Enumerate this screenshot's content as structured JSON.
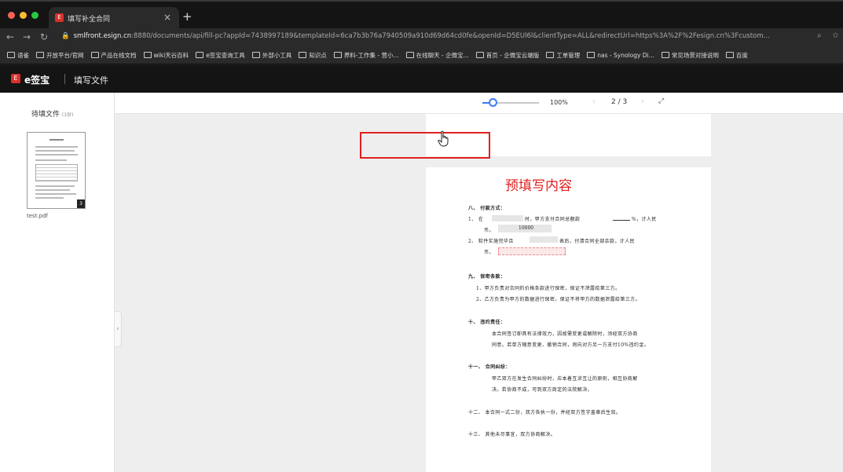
{
  "browser": {
    "tab_title": "填写补全合同",
    "close_symbol": "×",
    "new_tab_symbol": "+",
    "url_host": "smlfront.esign.cn",
    "url_rest": ":8880/documents/api/fill-pc?appId=7438997189&templateId=6ca7b3b76a7940509a910d69d64cd0fe&openId=D5EUl6l&clientType=ALL&redirectUrl=https%3A%2F%2Fesign.cn%3Fcustom...",
    "bookmarks": [
      "语雀",
      "开放平台/官网",
      "产品在线文档",
      "wiki天谷百科",
      "e签宝查询工具",
      "外部小工具",
      "知识点",
      "养料-工作集 - 营小...",
      "在线聊天 - 企微宝...",
      "首页 - 企微宝云端版",
      "工单管理",
      "nas - Synology Di...",
      "常见场景对接说明",
      "百度"
    ]
  },
  "app": {
    "logo_mark": "E",
    "logo_text": "e签宝",
    "title": "填写文件"
  },
  "sidebar": {
    "title": "待填文件",
    "count": "(1份)",
    "file_name": "test.pdf",
    "page_badge": "3"
  },
  "toolbar": {
    "zoom_level": "100%",
    "zoom_fraction": 0.15,
    "current_page": "2",
    "page_separator": "/",
    "total_pages": "3",
    "prev_symbol": "‹",
    "next_symbol": "›",
    "expand_symbol": "⤢"
  },
  "document": {
    "sec8_title": "八、  付款方式：",
    "sec8_l1a": "1、 在",
    "sec8_l1b": "时，甲方支付合同总额款",
    "sec8_l1c": "%，计人民",
    "sec8_l2a": "币。",
    "sec8_field_value": "10000",
    "sec8_l3a": "2、 软件实施完毕且",
    "sec8_l3b": "表后，付清合同全部余款，计人民",
    "sec8_l4a": "币。",
    "sec9_title": "九、  保密条款：",
    "sec9_l1": "1、甲方负责对合同的价格条款进行保密，保证不泄露给第三方。",
    "sec9_l2": "2、乙方负责为甲方的数据进行保密，保证不将甲方的数据泄露给第三方。",
    "sec10_title": "十、  违约责任：",
    "sec10_l1": "本合同签订即具有法律效力，因故需变更或解除时，须经双方协商",
    "sec10_l2": "同意。若单方随意变更、撤销合同，则向对方另一方支付10%违约金。",
    "sec11_title": "十一、    合同纠纷：",
    "sec11_l1": "甲乙双方在发生合同纠纷时，应本着互谅互让的原则，相互协商解",
    "sec11_l2": "决。若协商不成，可到双方商定的法院解决。",
    "sec12": "十二、    本合同一式二份，双方各执一份，并经双方签字盖章后生效。",
    "sec13": "十三、    其他未尽事宜，双方协商解决。"
  },
  "annotation": {
    "text": "预填写内容",
    "color": "#e02020"
  },
  "colors": {
    "accent": "#3b7bf6",
    "brand": "#d9312b"
  }
}
